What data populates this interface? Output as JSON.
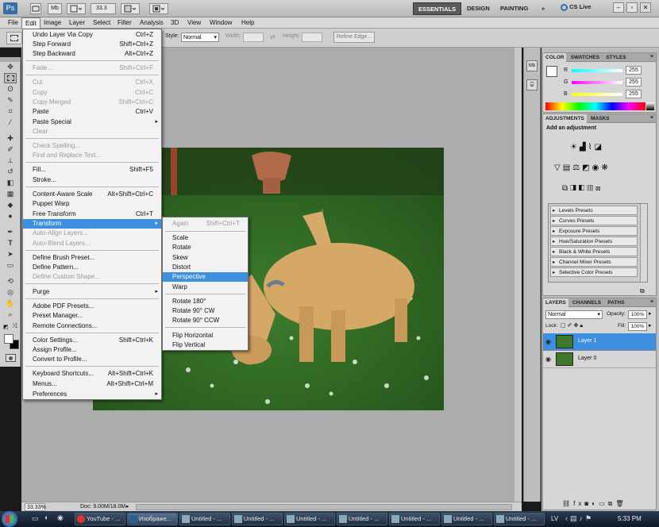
{
  "appbar": {
    "logo": "Ps",
    "mb_label": "Mb",
    "zoom": "33.3",
    "workspaces": [
      "ESSENTIALS",
      "DESIGN",
      "PAINTING"
    ],
    "more": "»",
    "cslive": "CS Live"
  },
  "menubar": [
    "File",
    "Edit",
    "Image",
    "Layer",
    "Select",
    "Filter",
    "Analysis",
    "3D",
    "View",
    "Window",
    "Help"
  ],
  "options": {
    "style_label": "Style:",
    "style_value": "Normal",
    "width_label": "Width:",
    "height_label": "Height:",
    "refine_edge": "Refine Edge..."
  },
  "edit_menu": [
    {
      "label": "Undo Layer Via Copy",
      "shortcut": "Ctrl+Z",
      "disabled": false
    },
    {
      "label": "Step Forward",
      "shortcut": "Shift+Ctrl+Z",
      "disabled": false
    },
    {
      "label": "Step Backward",
      "shortcut": "Alt+Ctrl+Z",
      "disabled": false
    },
    {
      "label": "Fade...",
      "shortcut": "Shift+Ctrl+F",
      "disabled": true
    },
    {
      "label": "Cut",
      "shortcut": "Ctrl+X",
      "disabled": true
    },
    {
      "label": "Copy",
      "shortcut": "Ctrl+C",
      "disabled": true
    },
    {
      "label": "Copy Merged",
      "shortcut": "Shift+Ctrl+C",
      "disabled": true
    },
    {
      "label": "Paste",
      "shortcut": "Ctrl+V",
      "disabled": false
    },
    {
      "label": "Paste Special",
      "shortcut": "",
      "disabled": false,
      "submenu": true
    },
    {
      "label": "Clear",
      "shortcut": "",
      "disabled": true
    },
    {
      "label": "Check Spelling...",
      "shortcut": "",
      "disabled": true
    },
    {
      "label": "Find and Replace Text...",
      "shortcut": "",
      "disabled": true
    },
    {
      "label": "Fill...",
      "shortcut": "Shift+F5",
      "disabled": false
    },
    {
      "label": "Stroke...",
      "shortcut": "",
      "disabled": false
    },
    {
      "label": "Content-Aware Scale",
      "shortcut": "Alt+Shift+Ctrl+C",
      "disabled": false
    },
    {
      "label": "Puppet Warp",
      "shortcut": "",
      "disabled": false
    },
    {
      "label": "Free Transform",
      "shortcut": "Ctrl+T",
      "disabled": false
    },
    {
      "label": "Transform",
      "shortcut": "",
      "disabled": false,
      "submenu": true,
      "highlighted": true
    },
    {
      "label": "Auto-Align Layers...",
      "shortcut": "",
      "disabled": true
    },
    {
      "label": "Auto-Blend Layers...",
      "shortcut": "",
      "disabled": true
    },
    {
      "label": "Define Brush Preset...",
      "shortcut": "",
      "disabled": false
    },
    {
      "label": "Define Pattern...",
      "shortcut": "",
      "disabled": false
    },
    {
      "label": "Define Custom Shape...",
      "shortcut": "",
      "disabled": true
    },
    {
      "label": "Purge",
      "shortcut": "",
      "disabled": false,
      "submenu": true
    },
    {
      "label": "Adobe PDF Presets...",
      "shortcut": "",
      "disabled": false
    },
    {
      "label": "Preset Manager...",
      "shortcut": "",
      "disabled": false
    },
    {
      "label": "Remote Connections...",
      "shortcut": "",
      "disabled": false
    },
    {
      "label": "Color Settings...",
      "shortcut": "Shift+Ctrl+K",
      "disabled": false
    },
    {
      "label": "Assign Profile...",
      "shortcut": "",
      "disabled": false
    },
    {
      "label": "Convert to Profile...",
      "shortcut": "",
      "disabled": false
    },
    {
      "label": "Keyboard Shortcuts...",
      "shortcut": "Alt+Shift+Ctrl+K",
      "disabled": false
    },
    {
      "label": "Menus...",
      "shortcut": "Alt+Shift+Ctrl+M",
      "disabled": false
    },
    {
      "label": "Preferences",
      "shortcut": "",
      "disabled": false,
      "submenu": true
    }
  ],
  "transform_menu": [
    {
      "label": "Again",
      "shortcut": "Shift+Ctrl+T",
      "disabled": true
    },
    {
      "label": "Scale",
      "shortcut": "",
      "disabled": false
    },
    {
      "label": "Rotate",
      "shortcut": "",
      "disabled": false
    },
    {
      "label": "Skew",
      "shortcut": "",
      "disabled": false
    },
    {
      "label": "Distort",
      "shortcut": "",
      "disabled": false
    },
    {
      "label": "Perspective",
      "shortcut": "",
      "disabled": false,
      "highlighted": true
    },
    {
      "label": "Warp",
      "shortcut": "",
      "disabled": false
    },
    {
      "label": "Rotate 180°",
      "shortcut": "",
      "disabled": false
    },
    {
      "label": "Rotate 90° CW",
      "shortcut": "",
      "disabled": false
    },
    {
      "label": "Rotate 90° CCW",
      "shortcut": "",
      "disabled": false
    },
    {
      "label": "Flip Horizontal",
      "shortcut": "",
      "disabled": false
    },
    {
      "label": "Flip Vertical",
      "shortcut": "",
      "disabled": false
    }
  ],
  "color_panel": {
    "tabs": [
      "COLOR",
      "SWATCHES",
      "STYLES"
    ],
    "channels": [
      {
        "name": "R",
        "value": "255"
      },
      {
        "name": "G",
        "value": "255"
      },
      {
        "name": "B",
        "value": "255"
      }
    ]
  },
  "adjustments_panel": {
    "tabs": [
      "ADJUSTMENTS",
      "MASKS"
    ],
    "title": "Add an adjustment",
    "presets": [
      "Levels Presets",
      "Curves Presets",
      "Exposure Presets",
      "Hue/Saturation Presets",
      "Black & White Presets",
      "Channel Mixer Presets",
      "Selective Color Presets"
    ]
  },
  "layers_panel": {
    "tabs": [
      "LAYERS",
      "CHANNELS",
      "PATHS"
    ],
    "blend_mode": "Normal",
    "opacity_label": "Opacity:",
    "opacity": "100%",
    "lock_label": "Lock:",
    "fill_label": "Fill:",
    "fill": "100%",
    "layers": [
      {
        "name": "Layer 1",
        "selected": true
      },
      {
        "name": "Layer 0",
        "selected": false
      }
    ]
  },
  "status": {
    "zoom": "33.33%",
    "doc": "Doc: 9.00M/18.0M"
  },
  "taskbar": {
    "buttons": [
      "YouTube - ...",
      "Изображе...",
      "Untitled - ...",
      "Untitled - ...",
      "Untitled - ...",
      "Untitled - ...",
      "Untitled - ...",
      "Untitled - ...",
      "Untitled - ..."
    ],
    "lang": "LV",
    "time": "5:33 PM"
  },
  "colors": {
    "highlight": "#3d8fe0",
    "selected_layer": "#3d8fe0"
  }
}
